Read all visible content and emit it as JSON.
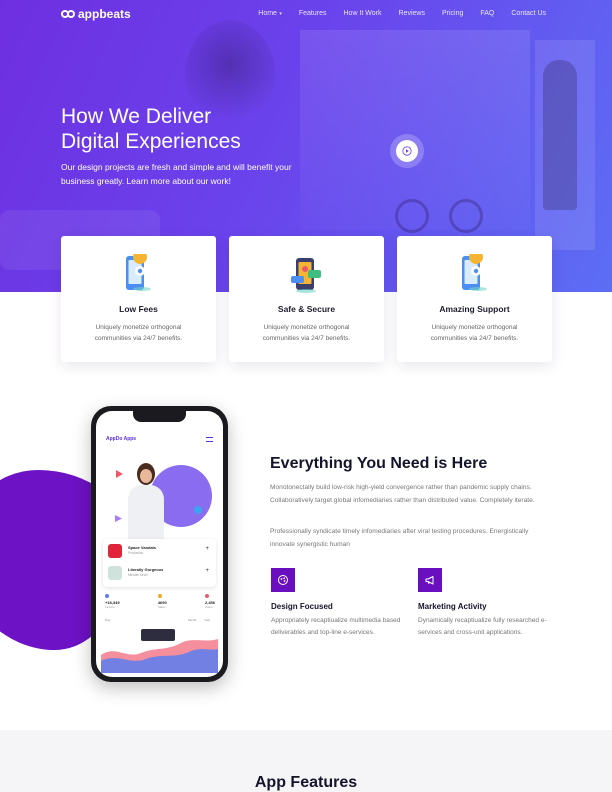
{
  "brand": {
    "name": "appbeats"
  },
  "nav": {
    "items": [
      {
        "label": "Home",
        "has_caret": true
      },
      {
        "label": "Features"
      },
      {
        "label": "How It Work"
      },
      {
        "label": "Reviews"
      },
      {
        "label": "Pricing"
      },
      {
        "label": "FAQ"
      },
      {
        "label": "Contact Us"
      }
    ]
  },
  "hero": {
    "title_line1": "How We Deliver",
    "title_line2": "Digital Experiences",
    "text": "Our design projects are fresh and simple and will benefit your business greatly. Learn more about our work!"
  },
  "cards": [
    {
      "title": "Low Fees",
      "text": "Uniquely monetize orthogonal communities via 24/7 benefits.",
      "icon": "phone-location-icon"
    },
    {
      "title": "Safe & Secure",
      "text": "Uniquely monetize orthogonal communities via 24/7 benefits.",
      "icon": "phone-chat-icon"
    },
    {
      "title": "Amazing Support",
      "text": "Uniquely monetize orthogonal communities via 24/7 benefits.",
      "icon": "phone-location-icon"
    }
  ],
  "phone_app": {
    "title": "AppDo Apps",
    "list": [
      {
        "name": "Space Vandals",
        "sub": "Production"
      },
      {
        "name": "Literally Gorgeous",
        "sub": "Michael Kevin"
      }
    ],
    "stats": [
      {
        "value": "+18,349",
        "label": "Income",
        "color": "#5a7cf0"
      },
      {
        "value": "4690",
        "label": "Sales",
        "color": "#f5a623"
      },
      {
        "value": "2,456",
        "label": "Users",
        "color": "#ef5a6a"
      }
    ],
    "tabs": [
      "Day",
      "Month",
      "Year"
    ]
  },
  "about": {
    "title": "Everything You Need is Here",
    "p1": "Monotonectally build low-risk high-yield convergence rather than pandemic supply chains. Collaboratively target global infomediaries rather than distributed value. Completely iterate.",
    "p2": "Professionally syndicate timely infomediaries after viral testing procedures. Energistically innovate synergistic human",
    "features": [
      {
        "title": "Design Focused",
        "text": "Appropriately recaptiualize multimedia based deliverables and top-line e-services.",
        "icon": "design-icon"
      },
      {
        "title": "Marketing Activity",
        "text": "Dynamically recaptiualize fully researched e-services and cross-unit applications.",
        "icon": "megaphone-icon"
      }
    ]
  },
  "features_section": {
    "title": "App Features"
  },
  "colors": {
    "accent": "#6a0fbf",
    "hero_start": "#6e2fe0",
    "hero_end": "#5c6ef4"
  }
}
